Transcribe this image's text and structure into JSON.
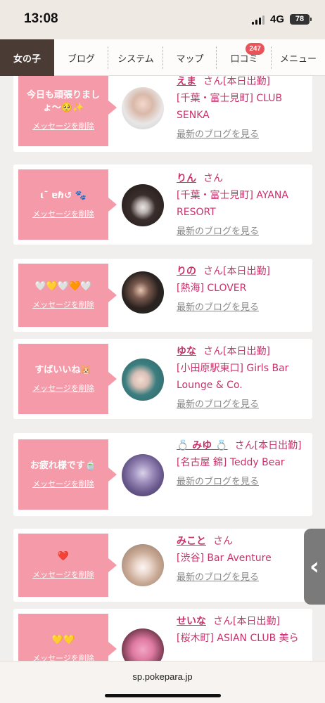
{
  "status": {
    "time": "13:08",
    "network": "4G",
    "battery": "78"
  },
  "nav": [
    {
      "label": "女の子"
    },
    {
      "label": "ブログ"
    },
    {
      "label": "システム"
    },
    {
      "label": "マップ"
    },
    {
      "label": "口コミ",
      "badge": "247"
    },
    {
      "label": "メニュー"
    }
  ],
  "cards": [
    {
      "message": "今日も頑張りましょ〜🥺✨",
      "delete_label": "メッセージを削除",
      "name": "えま",
      "suffix": "さん[本日出勤]",
      "shop": "[千葉・富士見町] CLUB SENKA",
      "blog_label": "最新のブログを見る"
    },
    {
      "message": "ι¯ ɐℏ↺ 🐾",
      "delete_label": "メッセージを削除",
      "name": "りん",
      "suffix": "さん",
      "shop": "[千葉・富士見町] AYANA RESORT",
      "blog_label": "最新のブログを見る"
    },
    {
      "message": "🤍💛🤍🧡🤍",
      "delete_label": "メッセージを削除",
      "name": "りの",
      "suffix": "さん[本日出勤]",
      "shop": "[熱海] CLOVER",
      "blog_label": "最新のブログを見る"
    },
    {
      "message": "すばいいね🐹",
      "delete_label": "メッセージを削除",
      "name": "ゆな",
      "suffix": "さん[本日出勤]",
      "shop": "[小田原駅東口] Girls Bar Lounge & Co.",
      "blog_label": "最新のブログを見る"
    },
    {
      "message": "お疲れ様です🍵",
      "delete_label": "メッセージを削除",
      "name": "💍 みゆ 💍",
      "suffix": "さん[本日出勤]",
      "shop": "[名古屋 錦] Teddy Bear",
      "blog_label": "最新のブログを見る"
    },
    {
      "message": "❤️",
      "delete_label": "メッセージを削除",
      "name": "みこと",
      "suffix": "さん",
      "shop": "[渋谷] Bar Aventure",
      "blog_label": "最新のブログを見る"
    },
    {
      "message": "💛💛",
      "delete_label": "メッセージを削除",
      "name": "せいな",
      "suffix": "さん[本日出勤]",
      "shop": "[桜木町] ASIAN CLUB 美ら",
      "blog_label": ""
    }
  ],
  "side_tab_icon": "chevron-left-icon",
  "url": "sp.pokepara.jp"
}
